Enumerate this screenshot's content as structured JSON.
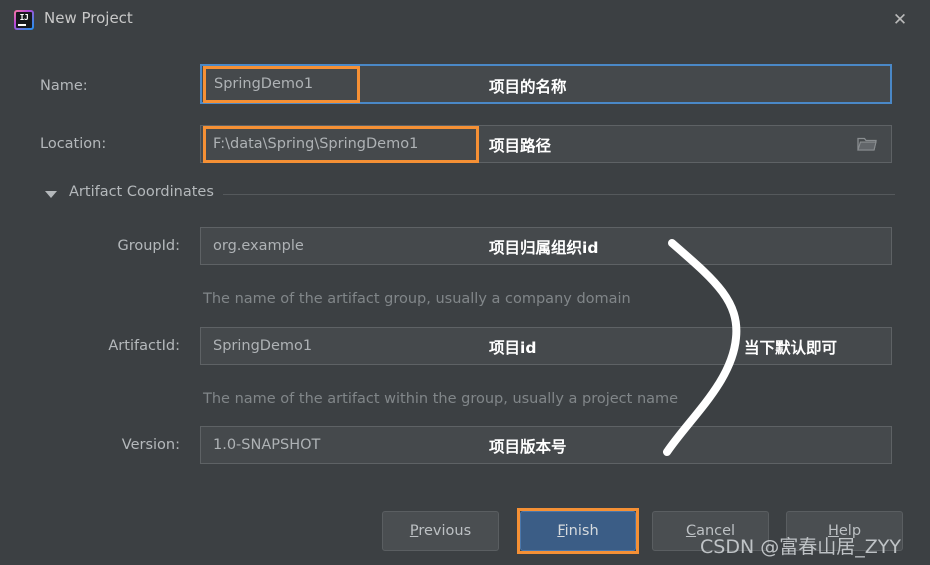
{
  "window": {
    "title": "New Project",
    "app_icon": "intellij-idea-icon",
    "close_icon": "close-icon"
  },
  "form": {
    "name": {
      "label": "Name:",
      "value": "SpringDemo1",
      "annotation": "项目的名称"
    },
    "location": {
      "label": "Location:",
      "value": "F:\\data\\Spring\\SpringDemo1",
      "annotation": "项目路径",
      "browse_icon": "folder-icon"
    },
    "artifact_coordinates": {
      "title": "Artifact Coordinates",
      "collapse_icon": "chevron-down-icon"
    },
    "group_id": {
      "label": "GroupId:",
      "value": "org.example",
      "hint": "The name of the artifact group, usually a company domain",
      "annotation": "项目归属组织id"
    },
    "artifact_id": {
      "label": "ArtifactId:",
      "value": "SpringDemo1",
      "hint": "The name of the artifact within the group, usually a project name",
      "annotation": "项目id"
    },
    "version": {
      "label": "Version:",
      "value": "1.0-SNAPSHOT",
      "annotation": "项目版本号"
    },
    "default_note": "当下默认即可"
  },
  "footer": {
    "previous": {
      "label_pre": "",
      "mnemonic": "P",
      "label_post": "revious"
    },
    "finish": {
      "label_pre": "",
      "mnemonic": "F",
      "label_post": "inish"
    },
    "cancel": {
      "label_pre": "",
      "mnemonic": "C",
      "label_post": "ancel"
    },
    "help": {
      "label_pre": "",
      "mnemonic": "H",
      "label_post": "elp"
    }
  },
  "watermark": "CSDN @富春山居_ZYY",
  "colors": {
    "dialog_bg": "#3c4043",
    "field_bg": "#45494c",
    "highlight_orange": "#f59035",
    "focus_blue": "#4a88c7",
    "finish_blue": "#3b5d86",
    "text": "#b4b8bb",
    "hint_text": "#818689",
    "annotation_white": "#ffffff"
  }
}
